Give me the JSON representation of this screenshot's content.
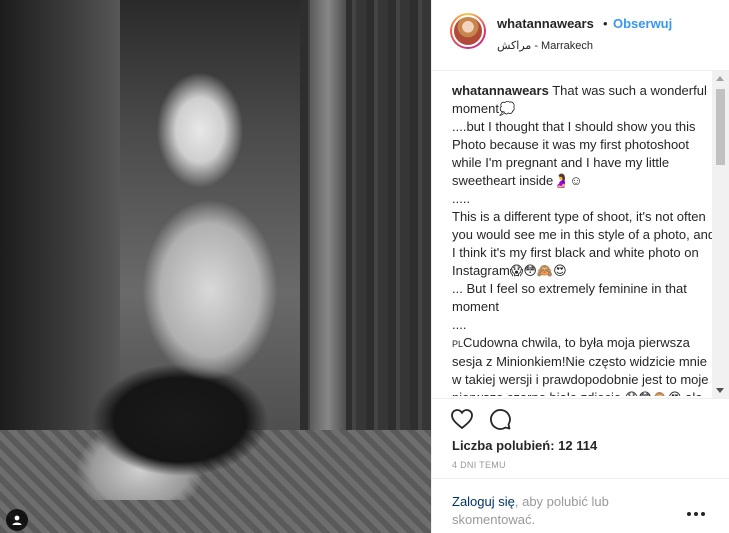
{
  "post": {
    "username": "whatannawears",
    "dot": "•",
    "follow_label": "Obserwuj",
    "location": "مراكش - Marrakech",
    "likes_label": "Liczba polubień: 12 114",
    "time_ago": "4 DNI TEMU"
  },
  "caption": {
    "author": "whatannawears",
    "lines": [
      " That was such a wonderful moment💭",
      "....but I thought that I should show you this Photo because it was my first photoshoot while I'm pregnant and I have my little sweetheart inside🤰☺",
      ".....",
      "This is a different type of shoot, it's not often you would see me in this style of a photo, and I think it's my first black and white photo on Instagram😱😳🙈😍",
      "... But I feel so extremely feminine in that moment",
      "....",
      "Cudowna chwila, to była moja pierwsza sesja z Minionkiem!Nie często widzicie mnie w takiej wersji i prawdopodobnie jest to moje pierwsze czarno białe zdjęcie 😱😳🙈😍 ale czułam się wtedy extremalnie kobieco!"
    ],
    "pl_tag": "PL"
  },
  "login": {
    "link": "Zaloguj się",
    "rest": ", aby polubić lub skomentować."
  },
  "icons": {
    "heart": "heart-icon",
    "comment": "comment-icon",
    "more": "more-icon",
    "user_tag": "user-tag-icon"
  },
  "colors": {
    "follow": "#3897f0",
    "link": "#003569",
    "muted": "#999999"
  }
}
